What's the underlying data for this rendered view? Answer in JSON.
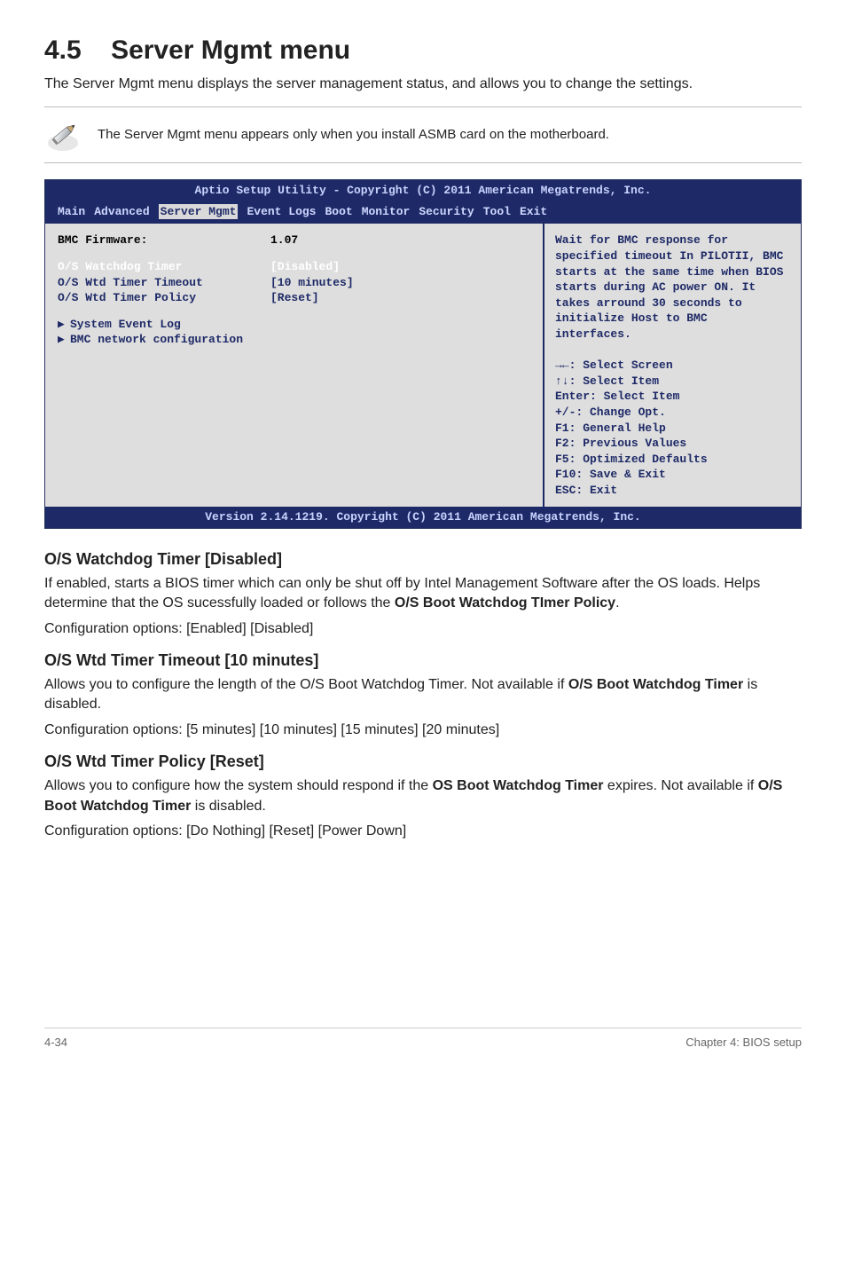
{
  "page": {
    "section_number": "4.5",
    "section_title": "Server Mgmt menu",
    "intro": "The Server Mgmt menu displays the server management status, and allows you to change the settings.",
    "note": "The Server Mgmt menu appears only when you install ASMB card on the motherboard."
  },
  "bios": {
    "header": "Aptio Setup Utility - Copyright (C) 2011 American Megatrends, Inc.",
    "tabs": [
      "Main",
      "Advanced",
      "Server Mgmt",
      "Event Logs",
      "Boot",
      "Monitor",
      "Security",
      "Tool",
      "Exit"
    ],
    "fw_label": "BMC Firmware:",
    "fw_val": "1.07",
    "rows": [
      {
        "label": "O/S Watchdog Timer",
        "value": "[Disabled]",
        "selected": true
      },
      {
        "label": "O/S Wtd Timer Timeout",
        "value": "[10 minutes]",
        "selected": false
      },
      {
        "label": "O/S Wtd Timer Policy",
        "value": "[Reset]",
        "selected": false
      }
    ],
    "links": [
      "System Event Log",
      "BMC network configuration"
    ],
    "help_top": "Wait for BMC response for specified timeout In PILOTII, BMC starts at the same time when BIOS starts during AC power ON. It takes arround 30 seconds to initialize Host to BMC interfaces.",
    "help_bottom": [
      "→←: Select Screen",
      "↑↓:  Select Item",
      "Enter: Select Item",
      "+/-: Change Opt.",
      "F1: General Help",
      "F2: Previous Values",
      "F5: Optimized Defaults",
      "F10: Save & Exit",
      "ESC: Exit"
    ],
    "footer": "Version 2.14.1219. Copyright (C) 2011 American Megatrends, Inc."
  },
  "doc": {
    "s1_h": "O/S Watchdog Timer [Disabled]",
    "s1_p1a": "If enabled, starts a BIOS timer which can only be shut off by Intel Management Software after the OS loads. Helps determine that the OS sucessfully loaded or follows the ",
    "s1_p1b": "O/S Boot Watchdog TImer Policy",
    "s1_p1c": ".",
    "s1_p2": "Configuration options: [Enabled] [Disabled]",
    "s2_h": "O/S Wtd Timer Timeout [10 minutes]",
    "s2_p1a": "Allows you to configure the length of the O/S Boot Watchdog Timer. Not available if ",
    "s2_p1b": "O/S Boot Watchdog Timer",
    "s2_p1c": " is disabled.",
    "s2_p2": "Configuration options: [5 minutes] [10 minutes] [15 minutes] [20 minutes]",
    "s3_h": "O/S Wtd Timer Policy [Reset]",
    "s3_p1a": "Allows you to configure how the system should respond if the ",
    "s3_p1b": "OS Boot Watchdog Timer",
    "s3_p1c": " expires. Not available if ",
    "s3_p1d": "O/S Boot Watchdog Timer",
    "s3_p1e": " is disabled.",
    "s3_p2": "Configuration options: [Do Nothing] [Reset] [Power Down]"
  },
  "footer": {
    "left": "4-34",
    "right": "Chapter 4: BIOS setup"
  },
  "chart_data": {
    "type": "table",
    "title": "BIOS Server Mgmt settings",
    "rows": [
      {
        "setting": "BMC Firmware",
        "value": "1.07"
      },
      {
        "setting": "O/S Watchdog Timer",
        "value": "Disabled"
      },
      {
        "setting": "O/S Wtd Timer Timeout",
        "value": "10 minutes"
      },
      {
        "setting": "O/S Wtd Timer Policy",
        "value": "Reset"
      }
    ]
  }
}
